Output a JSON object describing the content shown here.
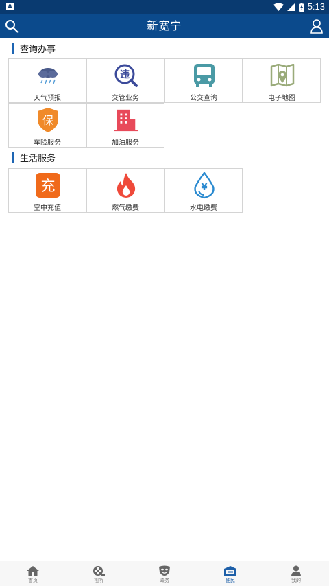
{
  "status_bar": {
    "notification_badge": "A",
    "time": "5:13"
  },
  "app_bar": {
    "title": "新宽宁"
  },
  "sections": [
    {
      "title": "查询办事",
      "items": [
        {
          "label": "天气预报",
          "icon": "weather-icon"
        },
        {
          "label": "交管业务",
          "icon": "traffic-violation-icon",
          "glyph": "违"
        },
        {
          "label": "公交查询",
          "icon": "bus-icon"
        },
        {
          "label": "电子地图",
          "icon": "map-icon"
        },
        {
          "label": "车险服务",
          "icon": "insurance-shield-icon",
          "glyph": "保"
        },
        {
          "label": "加油服务",
          "icon": "building-icon"
        }
      ]
    },
    {
      "title": "生活服务",
      "items": [
        {
          "label": "空中充值",
          "icon": "recharge-icon",
          "glyph": "充"
        },
        {
          "label": "燃气缴费",
          "icon": "flame-icon"
        },
        {
          "label": "水电缴费",
          "icon": "water-drop-yuan-icon",
          "glyph": "¥"
        }
      ]
    }
  ],
  "bottom_nav": [
    {
      "label": "首页",
      "icon": "home-icon",
      "active": false
    },
    {
      "label": "视听",
      "icon": "film-reel-icon",
      "active": false
    },
    {
      "label": "政务",
      "icon": "mask-icon",
      "active": false
    },
    {
      "label": "便民",
      "icon": "service-box-icon",
      "active": true
    },
    {
      "label": "我的",
      "icon": "person-icon",
      "active": false
    }
  ],
  "colors": {
    "status_bar": "#093a70",
    "app_bar": "#0b4a8c",
    "accent": "#1d65b3",
    "weather": "#4a5a8a",
    "traffic": "#3b4a9a",
    "bus": "#4a9aa5",
    "map": "#9aab7a",
    "insurance": "#f08a2a",
    "building": "#e84a5a",
    "recharge": "#f06a1a",
    "flame": "#ef4a3a",
    "water": "#2a8ad0"
  }
}
